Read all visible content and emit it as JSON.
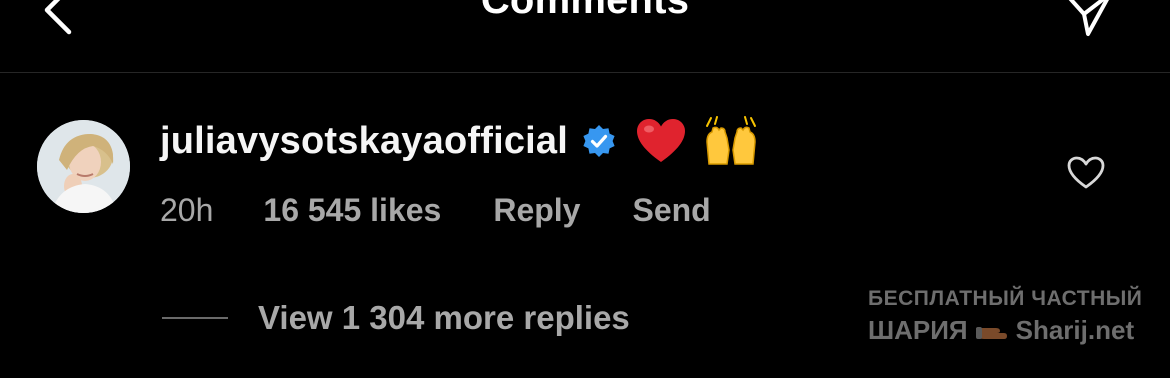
{
  "header": {
    "title": "Comments",
    "back_icon": "chevron-left-icon",
    "send_icon": "paper-plane-icon"
  },
  "comment": {
    "username": "juliavysotskayaofficial",
    "verified_icon": "verified-badge-icon",
    "text": "❤️🙌",
    "time": "20h",
    "likes": "16 545 likes",
    "reply_label": "Reply",
    "send_label": "Send",
    "like_icon": "heart-outline-icon"
  },
  "replies": {
    "label": "View 1 304 more replies"
  },
  "watermark": {
    "line1": "БЕСПЛАТНЫЙ ЧАСТНЫЙ",
    "line2_left": "ШАРИЯ",
    "line2_right": "Sharij.net"
  },
  "colors": {
    "background": "#000000",
    "text_primary": "#f5f5f5",
    "text_secondary": "#a8a8a8",
    "verified_blue": "#3797f0",
    "divider": "#262626"
  }
}
